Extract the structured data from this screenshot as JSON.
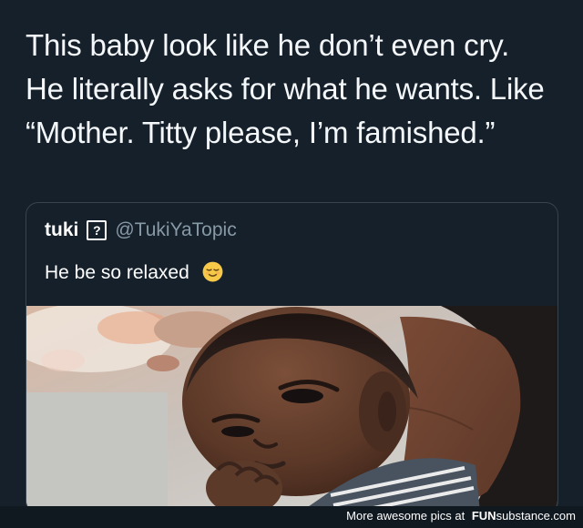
{
  "post": {
    "lines": [
      "This baby look like he don’t even cry.",
      "He literally asks for what he wants. Like",
      "“Mother. Titty please, I’m famished.”"
    ]
  },
  "quoted_tweet": {
    "name": "tuki",
    "badge": "?",
    "handle": "@TukiYaTopic",
    "text": "He be so relaxed",
    "emoji_icon": "relieved-face-icon",
    "photo_icon": "baby-photo-icon"
  },
  "footer": {
    "label": "More awesome pics at",
    "brand_strong": "FUN",
    "brand_rest": "substance.com"
  },
  "colors": {
    "background": "#15202b",
    "card_border": "#38444d",
    "handle": "#8899a6",
    "emoji": "#f7c948"
  }
}
